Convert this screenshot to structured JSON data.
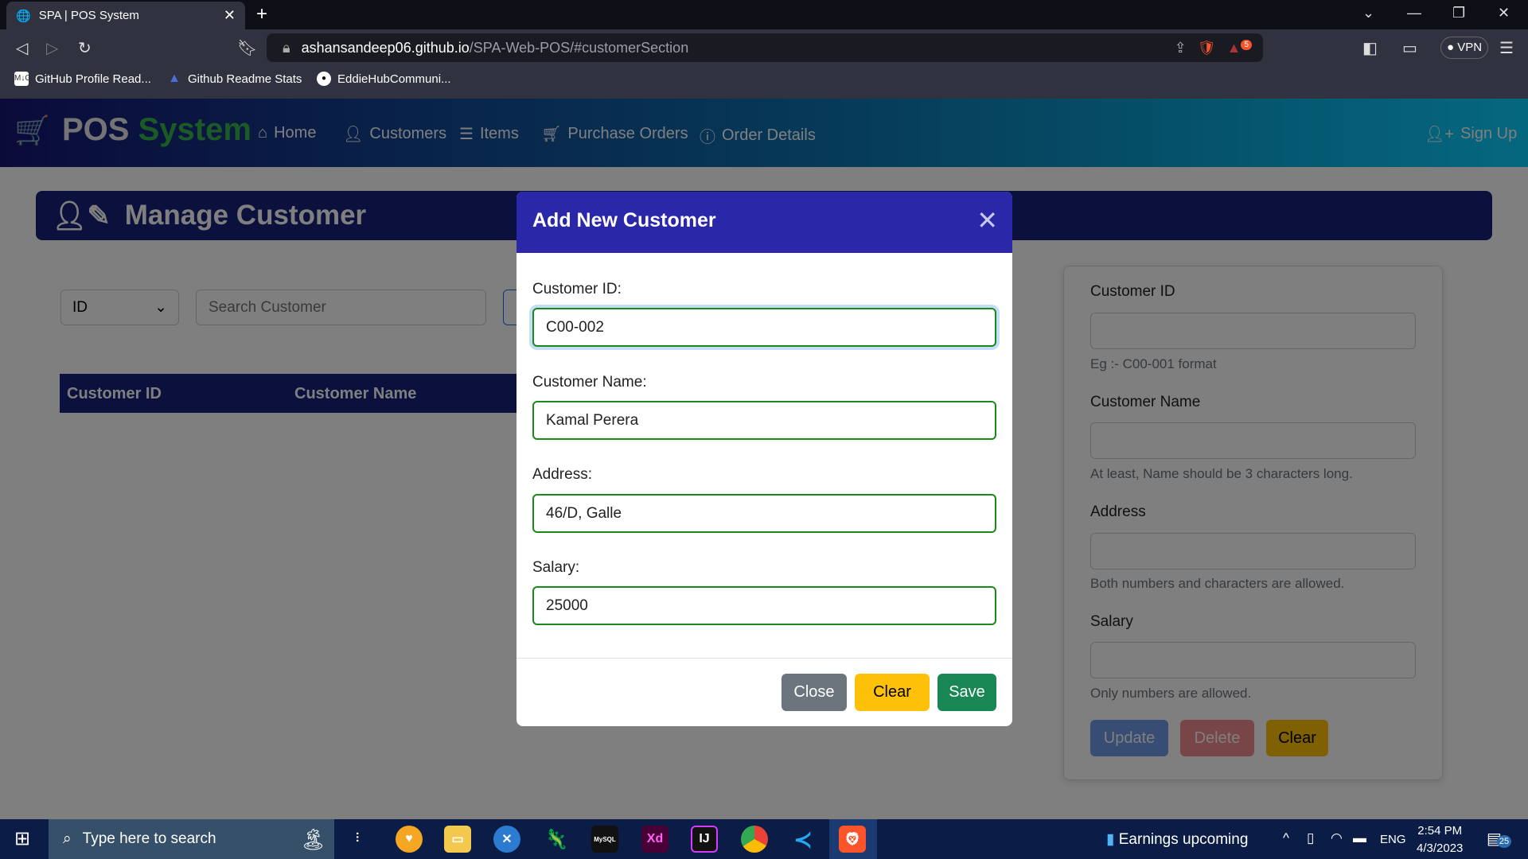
{
  "browser": {
    "tab_title": "SPA | POS System",
    "url_host": "ashansandeep06.github.io",
    "url_path": "/SPA-Web-POS/#customerSection",
    "vpn": "VPN",
    "rewards_badge": "5",
    "bookmarks": [
      "GitHub Profile Read...",
      "Github Readme Stats",
      "EddieHubCommuni..."
    ]
  },
  "nav": {
    "logo_a": "POS ",
    "logo_b": "System",
    "links": [
      "Home",
      "Customers",
      "Items",
      "Purchase Orders",
      "Order Details"
    ],
    "signup": "Sign Up"
  },
  "page": {
    "title": "Manage Customer",
    "filter_value": "ID",
    "search_placeholder": "Search Customer",
    "table_headers": [
      "Customer ID",
      "Customer Name"
    ]
  },
  "form": {
    "labels": [
      "Customer ID",
      "Customer Name",
      "Address",
      "Salary"
    ],
    "help": [
      "Eg :- C00-001 format",
      "At least, Name should be 3 characters long.",
      "Both numbers and characters are allowed.",
      "Only numbers are allowed."
    ],
    "buttons": {
      "update": "Update",
      "delete": "Delete",
      "clear": "Clear"
    }
  },
  "modal": {
    "title": "Add New Customer",
    "labels": [
      "Customer ID:",
      "Customer Name:",
      "Address:",
      "Salary:"
    ],
    "values": [
      "C00-002",
      "Kamal Perera",
      "46/D, Galle",
      "25000"
    ],
    "buttons": {
      "close": "Close",
      "clear": "Clear",
      "save": "Save"
    }
  },
  "taskbar": {
    "search_placeholder": "Type here to search",
    "news": "Earnings upcoming",
    "lang": "ENG",
    "time": "2:54 PM",
    "date": "4/3/2023",
    "notifications": "25"
  }
}
